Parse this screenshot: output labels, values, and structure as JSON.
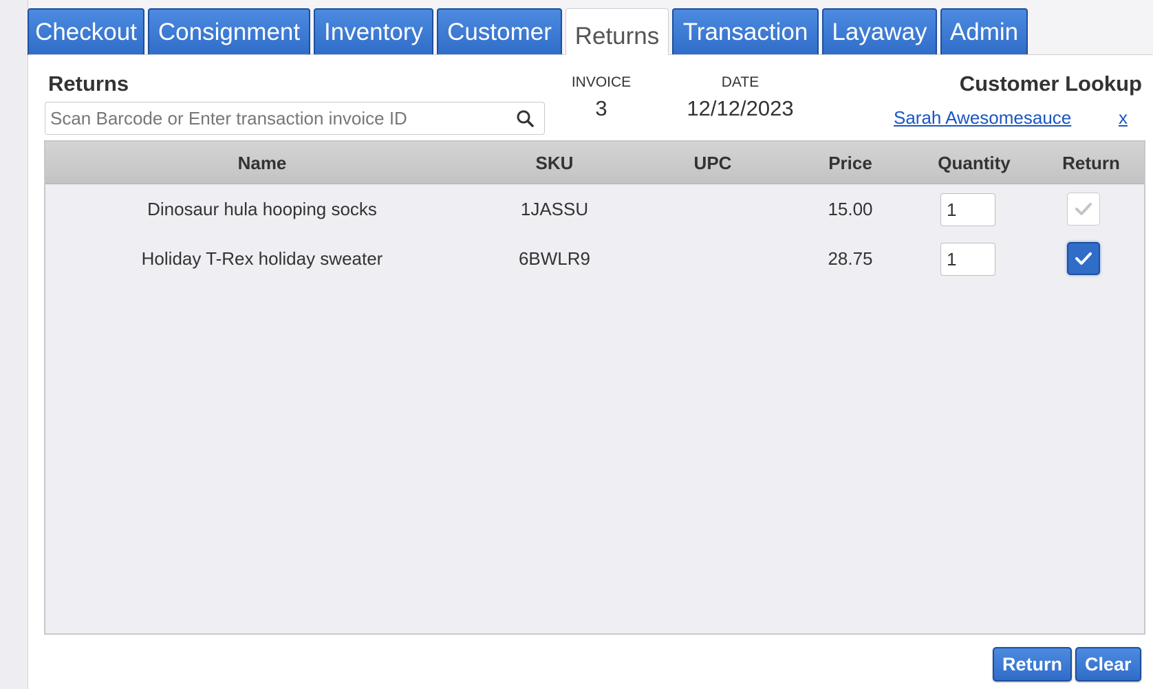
{
  "tabs": [
    {
      "label": "Checkout"
    },
    {
      "label": "Consignment"
    },
    {
      "label": "Inventory"
    },
    {
      "label": "Customer"
    },
    {
      "label": "Returns"
    },
    {
      "label": "Transaction"
    },
    {
      "label": "Layaway"
    },
    {
      "label": "Admin"
    }
  ],
  "returns": {
    "title": "Returns",
    "search_placeholder": "Scan Barcode or Enter transaction invoice ID",
    "search_value": ""
  },
  "invoice": {
    "label": "INVOICE",
    "value": "3"
  },
  "date": {
    "label": "DATE",
    "value": "12/12/2023"
  },
  "customer_lookup": {
    "title": "Customer Lookup",
    "customer_name": "Sarah Awesomesauce",
    "clear_label": "x"
  },
  "table": {
    "columns": [
      "Name",
      "SKU",
      "UPC",
      "Price",
      "Quantity",
      "Return"
    ],
    "rows": [
      {
        "name": "Dinosaur hula hooping socks",
        "sku": "1JASSU",
        "upc": "",
        "price": "15.00",
        "quantity": "1",
        "return_checked": false
      },
      {
        "name": "Holiday T-Rex holiday sweater",
        "sku": "6BWLR9",
        "upc": "",
        "price": "28.75",
        "quantity": "1",
        "return_checked": true
      }
    ]
  },
  "actions": {
    "return_label": "Return",
    "clear_label": "Clear"
  },
  "colors": {
    "accent": "#2f6dc9",
    "link": "#1a56c4"
  }
}
